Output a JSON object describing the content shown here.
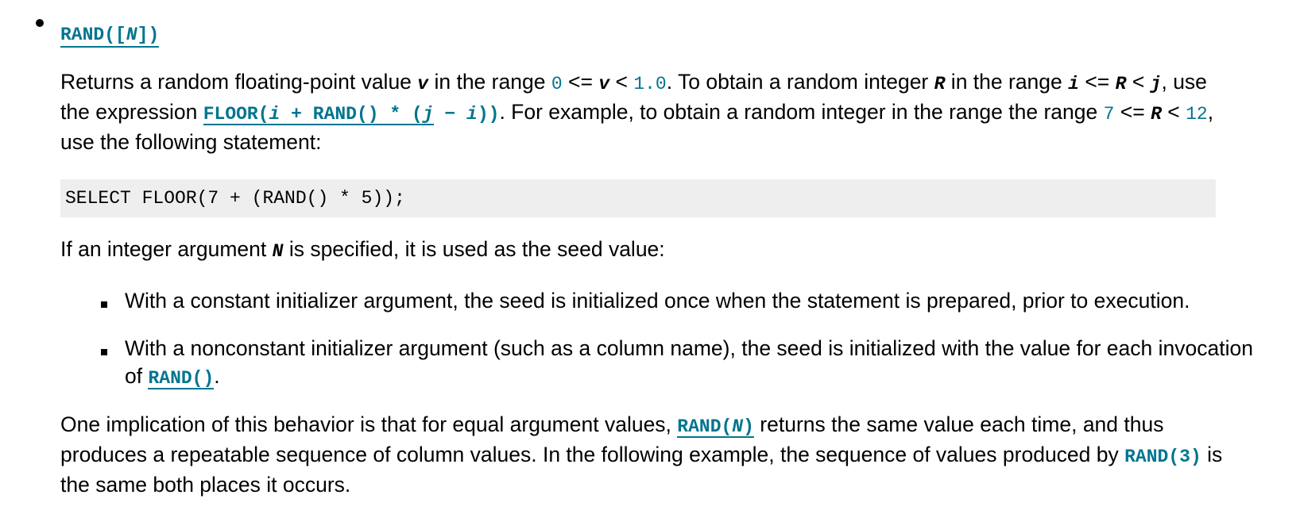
{
  "heading": {
    "func": "RAND",
    "open": "([",
    "arg": "N",
    "close": "])"
  },
  "para1": {
    "t1": "Returns a random floating-point value ",
    "v1": "v",
    "t2": " in the range ",
    "c1": "0",
    "t3": " <= ",
    "v2": "v",
    "t4": " < ",
    "c2": "1.0",
    "t5": ". To obtain a random integer ",
    "v3": "R",
    "t6": " in the range ",
    "v4": "i",
    "t7": " <= ",
    "v5": "R",
    "t8": " < ",
    "v6": "j",
    "t9": ", use the expression ",
    "expr_a": "FLOOR(",
    "expr_i": "i",
    "expr_b": " + RAND() * (",
    "expr_j": "j",
    "expr_c": " − ",
    "expr_i2": "i",
    "expr_d": "))",
    "t10": ". For example, to obtain a random integer in the range the range ",
    "c3": "7",
    "t11": " <= ",
    "v7": "R",
    "t12": " < ",
    "c4": "12",
    "t13": ", use the following statement:"
  },
  "code_block": "SELECT FLOOR(7 + (RAND() * 5));",
  "para2": {
    "t1": "If an integer argument ",
    "v1": "N",
    "t2": " is specified, it is used as the seed value:"
  },
  "list": {
    "item1": "With a constant initializer argument, the seed is initialized once when the statement is prepared, prior to execution.",
    "item2_text": "With a nonconstant initializer argument (such as a column name), the seed is initialized with the value for each invocation of ",
    "item2_link": "RAND()",
    "item2_end": "."
  },
  "para3": {
    "t1": "One implication of this behavior is that for equal argument values, ",
    "link1_a": "RAND(",
    "link1_n": "N",
    "link1_b": ")",
    "t2": " returns the same value each time, and thus produces a repeatable sequence of column values. In the following example, the sequence of values produced by ",
    "c1": "RAND(3)",
    "t3": " is the same both places it occurs."
  }
}
